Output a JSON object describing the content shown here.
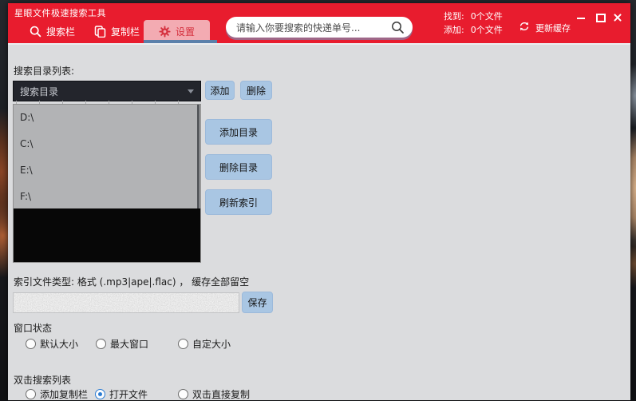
{
  "window": {
    "title": "星眼文件极速搜索工具",
    "controls": [
      "minimize-icon",
      "maximize-icon",
      "close-icon"
    ]
  },
  "header": {
    "tabs": [
      {
        "label": "搜索栏",
        "icon": "search-icon",
        "active": false
      },
      {
        "label": "复制栏",
        "icon": "copy-icon",
        "active": false
      },
      {
        "label": "设置",
        "icon": "gear-icon",
        "active": true
      }
    ],
    "search": {
      "placeholder": "请输入你要搜索的快递单号...",
      "icon": "search-icon"
    },
    "stats": [
      {
        "label": "找到:",
        "value": "0个文件"
      },
      {
        "label": "添加:",
        "value": "0个文件"
      }
    ],
    "update_cache": {
      "label": "更新缓存",
      "icon": "refresh-icon"
    }
  },
  "content": {
    "dir_section": {
      "label": "搜索目录列表:",
      "dropdown_value": "搜索目录",
      "add_button": "添加",
      "delete_button": "删除",
      "directories": [
        "D:\\",
        "C:\\",
        "E:\\",
        "F:\\"
      ],
      "add_dir_button": "添加目录",
      "delete_dir_button": "删除目录",
      "refresh_index_button": "刷新索引"
    },
    "index_section": {
      "label": "索引文件类型: 格式 (.mp3|ape|.flac) ， 缓存全部留空",
      "save_button": "保存"
    },
    "window_state": {
      "label": "窗口状态",
      "options": [
        {
          "label": "默认大小",
          "selected": false
        },
        {
          "label": "最大窗口",
          "selected": false
        },
        {
          "label": "自定大小",
          "selected": false
        }
      ]
    },
    "double_click": {
      "label": "双击搜索列表",
      "options": [
        {
          "label": "添加复制栏",
          "selected": false
        },
        {
          "label": "打开文件",
          "selected": true
        },
        {
          "label": "双击直接复制",
          "selected": false
        }
      ]
    }
  },
  "colors": {
    "header_red": "#e81c2e",
    "tab_active_pink": "#f3abb2",
    "tab_underline_blue": "#5b80aa",
    "button_blue": "#a9c6e3",
    "content_bg": "#dbdcde",
    "dropdown_bg": "#23252c",
    "list_gray": "#b2b3b5",
    "list_black": "#070707",
    "radio_selected_blue": "#2b7cd3"
  }
}
